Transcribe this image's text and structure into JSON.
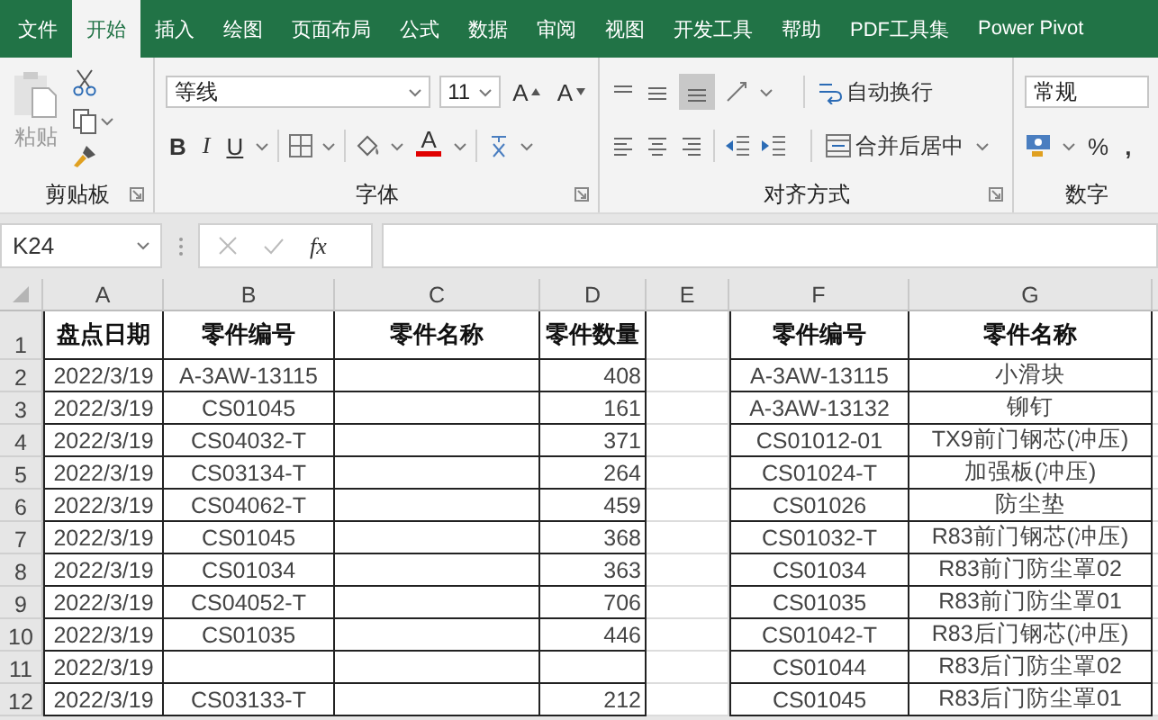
{
  "tabs": [
    {
      "label": "文件",
      "selected": false
    },
    {
      "label": "开始",
      "selected": true
    },
    {
      "label": "插入",
      "selected": false
    },
    {
      "label": "绘图",
      "selected": false
    },
    {
      "label": "页面布局",
      "selected": false
    },
    {
      "label": "公式",
      "selected": false
    },
    {
      "label": "数据",
      "selected": false
    },
    {
      "label": "审阅",
      "selected": false
    },
    {
      "label": "视图",
      "selected": false
    },
    {
      "label": "开发工具",
      "selected": false
    },
    {
      "label": "帮助",
      "selected": false
    },
    {
      "label": "PDF工具集",
      "selected": false
    },
    {
      "label": "Power Pivot",
      "selected": false
    }
  ],
  "ribbon": {
    "clipboard": {
      "paste": "粘贴",
      "title": "剪贴板"
    },
    "font": {
      "name": "等线",
      "size": "11",
      "grow": "A",
      "shrink": "A",
      "bold": "B",
      "italic": "I",
      "underline": "U",
      "font_color_label": "A",
      "title": "字体"
    },
    "alignment": {
      "wrap": "自动换行",
      "merge": "合并后居中",
      "title": "对齐方式"
    },
    "number": {
      "format": "常规",
      "percent": "%",
      "comma": ",",
      "title": "数字"
    }
  },
  "formula_bar": {
    "name_box": "K24",
    "fx": "fx"
  },
  "sheet": {
    "column_headers": [
      "A",
      "B",
      "C",
      "D",
      "E",
      "F",
      "G"
    ],
    "rows": [
      {
        "number": "1",
        "cells": [
          "盘点日期",
          "零件编号",
          "零件名称",
          "零件数量",
          null,
          "零件编号",
          "零件名称"
        ]
      },
      {
        "number": "2",
        "cells": [
          "2022/3/19",
          "A-3AW-13115",
          null,
          "408",
          null,
          "A-3AW-13115",
          "小滑块"
        ]
      },
      {
        "number": "3",
        "cells": [
          "2022/3/19",
          "CS01045",
          null,
          "161",
          null,
          "A-3AW-13132",
          "铆钉"
        ]
      },
      {
        "number": "4",
        "cells": [
          "2022/3/19",
          "CS04032-T",
          null,
          "371",
          null,
          "CS01012-01",
          "TX9前门钢芯(冲压)"
        ]
      },
      {
        "number": "5",
        "cells": [
          "2022/3/19",
          "CS03134-T",
          null,
          "264",
          null,
          "CS01024-T",
          "加强板(冲压)"
        ]
      },
      {
        "number": "6",
        "cells": [
          "2022/3/19",
          "CS04062-T",
          null,
          "459",
          null,
          "CS01026",
          "防尘垫"
        ]
      },
      {
        "number": "7",
        "cells": [
          "2022/3/19",
          "CS01045",
          null,
          "368",
          null,
          "CS01032-T",
          "R83前门钢芯(冲压)"
        ]
      },
      {
        "number": "8",
        "cells": [
          "2022/3/19",
          "CS01034",
          null,
          "363",
          null,
          "CS01034",
          "R83前门防尘罩02"
        ]
      },
      {
        "number": "9",
        "cells": [
          "2022/3/19",
          "CS04052-T",
          null,
          "706",
          null,
          "CS01035",
          "R83前门防尘罩01"
        ]
      },
      {
        "number": "10",
        "cells": [
          "2022/3/19",
          "CS01035",
          null,
          "446",
          null,
          "CS01042-T",
          "R83后门钢芯(冲压)"
        ]
      },
      {
        "number": "11",
        "cells": [
          "2022/3/19",
          null,
          null,
          null,
          null,
          "CS01044",
          "R83后门防尘罩02"
        ]
      },
      {
        "number": "12",
        "cells": [
          "2022/3/19",
          "CS03133-T",
          null,
          "212",
          null,
          "CS01045",
          "R83后门防尘罩01"
        ]
      }
    ]
  }
}
